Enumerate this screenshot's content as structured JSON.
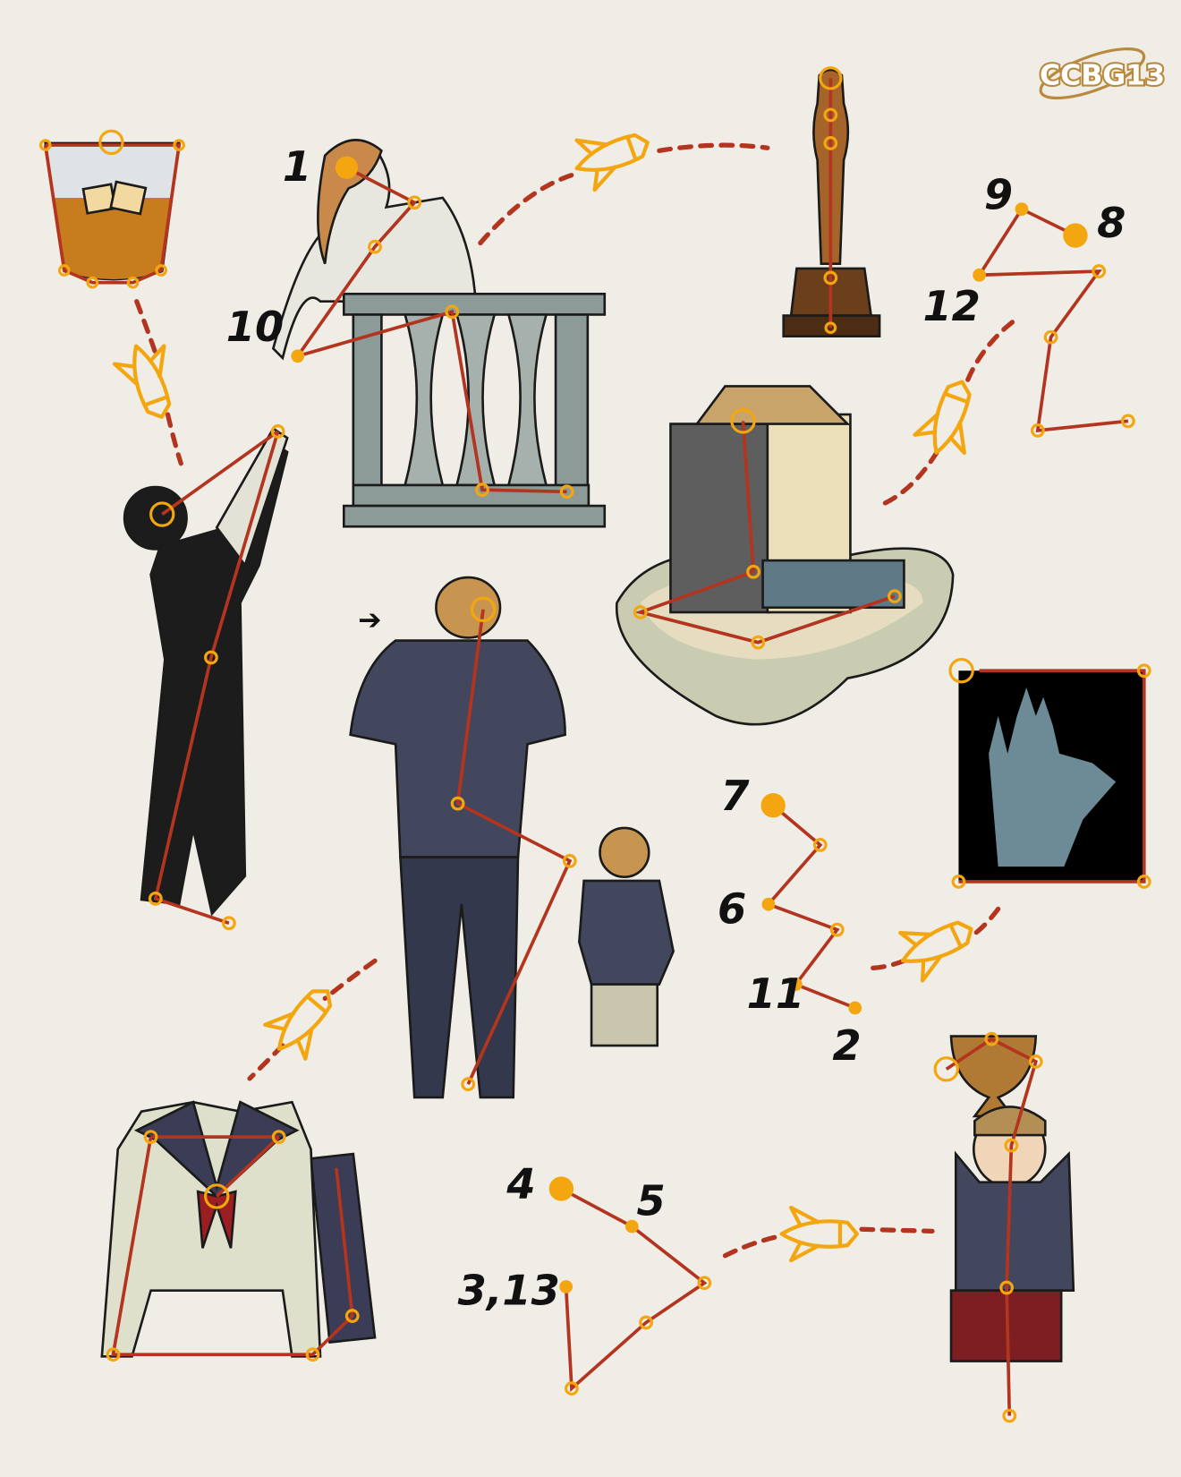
{
  "logo": {
    "text": "CCBG13"
  },
  "labels": {
    "n1": "1",
    "n10": "10",
    "n9": "9",
    "n8": "8",
    "n12": "12",
    "n7": "7",
    "n6": "6",
    "n11": "11",
    "n2": "2",
    "n4": "4",
    "n5": "5",
    "n3_13": "3,13"
  },
  "colors": {
    "background": "#efede5",
    "line": "#b3341f",
    "marker": "#f3a60f",
    "logo": "#b98a3e"
  }
}
